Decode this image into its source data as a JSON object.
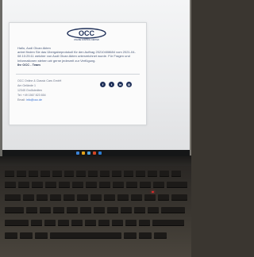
{
  "email": {
    "logo_text": "OCC",
    "logo_tagline": "ONLINE CONTROL CENTER",
    "greeting": "Hallo, Audi Olcan Akten",
    "body": "anbei finden Sie das Übergabeprotokoll für den Auftrag 20210408684 vom 2021-04-08 10:25:11 welcher von Audi Olcan Akten unterzeichnet wurde. Für Fragen und Informationen stehen wir gerne jederzeit zur Verfügung.",
    "signoff": "Ihr OCC - Team",
    "address": {
      "company": "OCC Online & Classic Cars GmbH",
      "street": "Am Gelände 1",
      "city": "12345 Großstedten",
      "phone": "Tel: +49 1567 823 654",
      "email_label": "Email:",
      "email": "info@occ.de"
    },
    "socials": [
      {
        "icon": "facebook-icon",
        "glyph": "f"
      },
      {
        "icon": "twitter-icon",
        "glyph": "t"
      },
      {
        "icon": "linkedin-icon",
        "glyph": "in"
      },
      {
        "icon": "instagram-icon",
        "glyph": "◎"
      }
    ]
  },
  "colors": {
    "brand_navy": "#1e2f58",
    "screen_bg": "#f1f2f4",
    "power_led": "#e02a2a"
  }
}
